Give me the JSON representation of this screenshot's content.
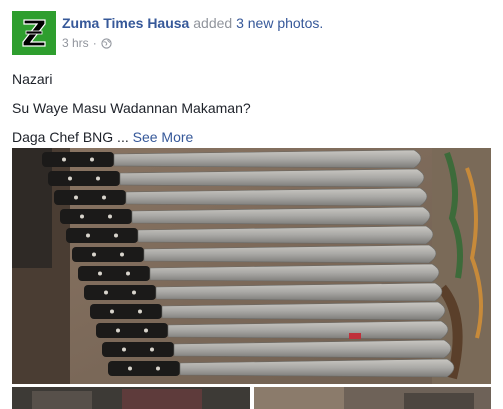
{
  "post": {
    "page_name": "Zuma Times Hausa",
    "action": "added",
    "new_photos": "3 new photos.",
    "timestamp": "3 hrs",
    "separator": "·",
    "privacy_icon": "globe-icon",
    "lines": {
      "line1": "Nazari",
      "line2": "Su Waye Masu Wadannan Makaman?",
      "line3_prefix": "Daga Chef BNG ...",
      "see_more": "See More"
    },
    "avatar": {
      "letter_icon": "z-logo-icon",
      "colors": {
        "background": "#2e9e2e",
        "letter": "#000000",
        "outline": "#ffffff"
      }
    }
  },
  "photos": {
    "main": {
      "subject": "machetes-photo"
    },
    "thumbnails": [
      "photo-thumbnail-2",
      "photo-thumbnail-3"
    ]
  },
  "colors": {
    "link": "#365899",
    "muted": "#90949c",
    "text": "#1d2129"
  }
}
